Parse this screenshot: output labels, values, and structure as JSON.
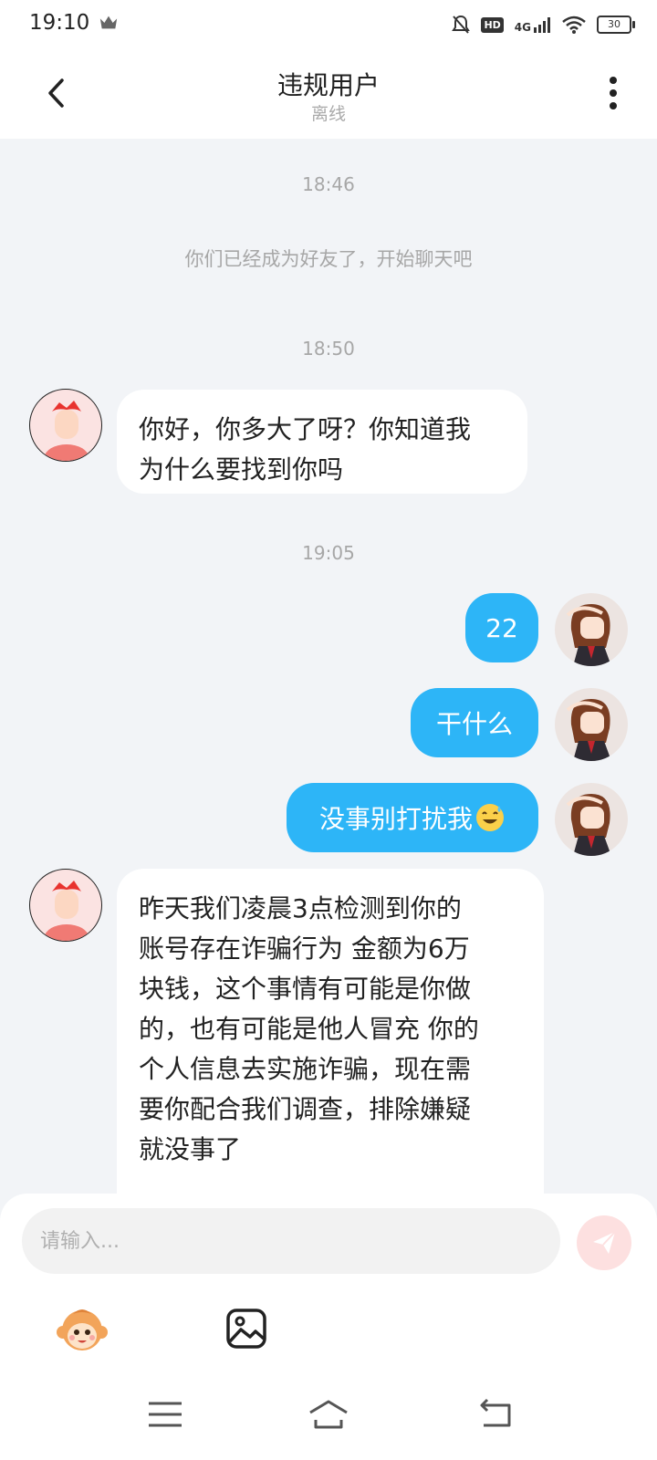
{
  "status_bar": {
    "time": "19:10",
    "network": "4G",
    "hd": "HD",
    "battery": "30"
  },
  "header": {
    "title": "违规用户",
    "subtitle": "离线"
  },
  "chat": {
    "time_1": "18:46",
    "system_message": "你们已经成为好友了，开始聊天吧",
    "time_2": "18:50",
    "msg_1": {
      "lines": [
        "你好，你多大了呀？你知道我",
        "为什么要找到你吗"
      ]
    },
    "time_3": "19:05",
    "msg_2": "22",
    "msg_3": "干什么",
    "msg_4": "没事别打扰我",
    "msg_5": {
      "lines": [
        "昨天我们凌晨3点检测到你的",
        "账号存在诈骗行为 金额为6万",
        "块钱，这个事情有可能是你做",
        "的，也有可能是他人冒充 你的",
        "个人信息去实施诈骗，现在需",
        "要你配合我们调查，排除嫌疑",
        "就没事了"
      ]
    }
  },
  "input": {
    "placeholder": "请输入...",
    "value": ""
  },
  "icons": {
    "back": "back-arrow-icon",
    "more": "more-vertical-icon",
    "send": "send-icon",
    "emoji": "monkey-emoji-icon",
    "image": "image-icon"
  },
  "colors": {
    "accent": "#2db5f7",
    "send_bg": "#fde0e0",
    "chat_bg": "#f2f4f7"
  }
}
